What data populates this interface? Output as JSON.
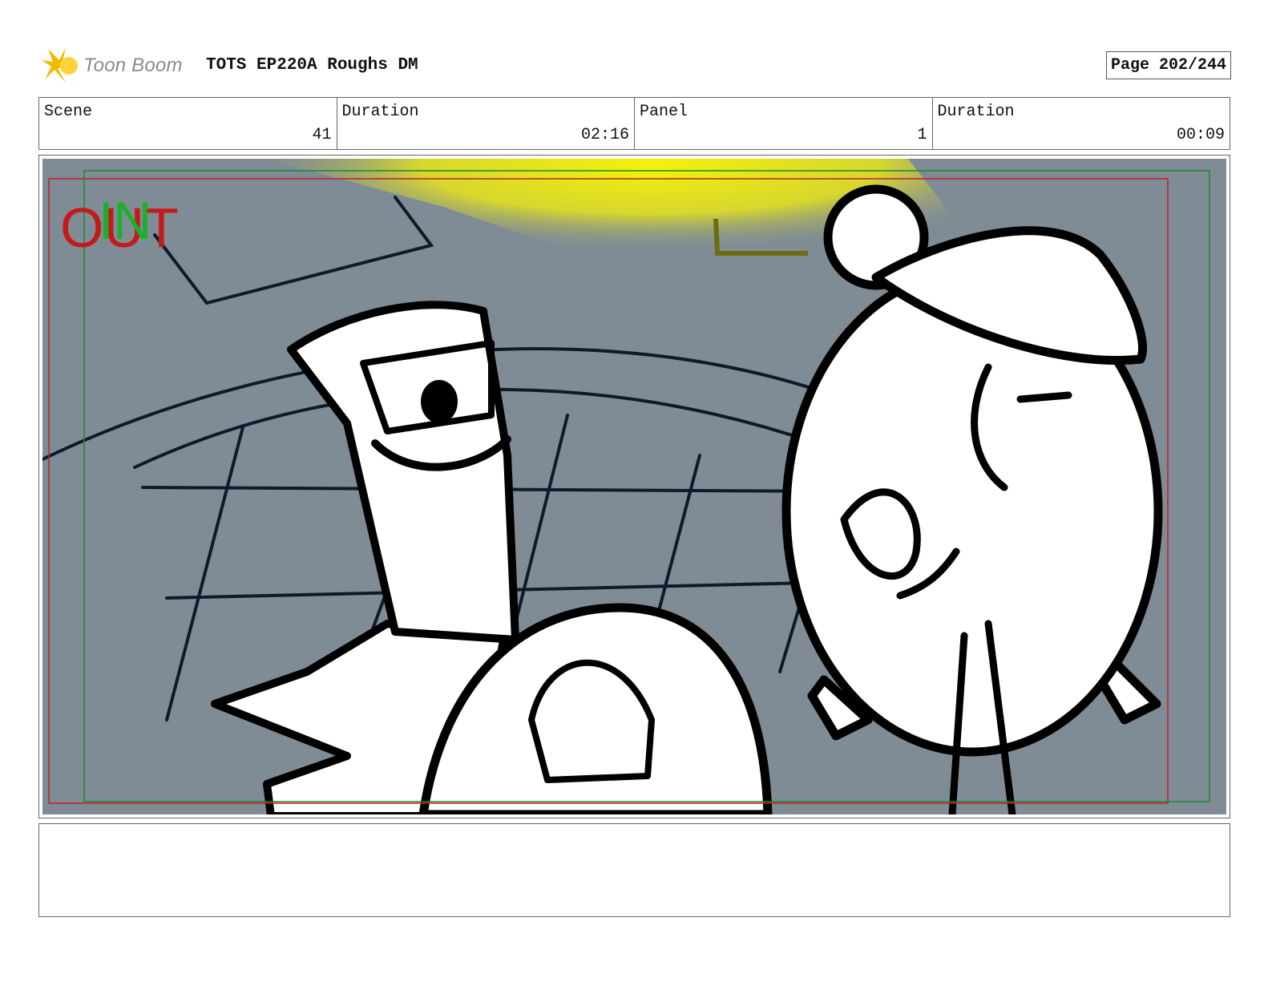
{
  "header": {
    "logo_text": "Toon Boom",
    "title": "TOTS EP220A Roughs DM",
    "page": "Page 202/244"
  },
  "info": {
    "scene_label": "Scene",
    "scene_value": "41",
    "scene_duration_label": "Duration",
    "scene_duration_value": "02:16",
    "panel_label": "Panel",
    "panel_value": "1",
    "panel_duration_label": "Duration",
    "panel_duration_value": "00:09"
  },
  "panel": {
    "out_marker": "OUT",
    "in_marker": "IN",
    "background_color": "#7f8c95",
    "spotlight_color": "#f2f01a",
    "out_frame_color": "#c0202a",
    "in_frame_color": "#1a8a2a"
  },
  "notes": {
    "text": ""
  }
}
